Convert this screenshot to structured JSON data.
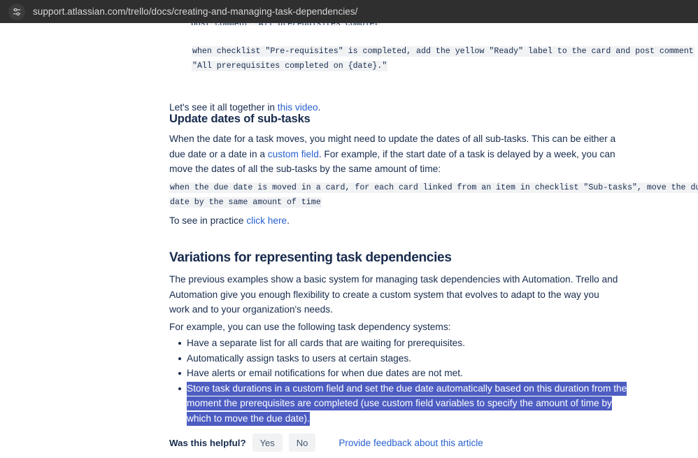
{
  "browser": {
    "url": "support.atlassian.com/trello/docs/creating-and-managing-task-dependencies/",
    "site_settings_icon": "sliders-icon"
  },
  "article": {
    "clipped_code_top": "post comment \"All prerequisites completed on {date}.\"",
    "code_block_1": {
      "line1": "when checklist \"Pre-requisites\" is completed, add the yellow \"Ready\" label to the card and post comment",
      "line2": "\"All prerequisites completed on {date}.\""
    },
    "video_sentence": {
      "before": "Let's see it all together in ",
      "link": "this video",
      "after": "."
    },
    "section_subtasks": {
      "heading": "Update dates of sub-tasks",
      "paragraph_part1": "When the date for a task moves, you might need to update the dates of all sub-tasks. This can be either a due date or a date in a ",
      "paragraph_link": "custom field",
      "paragraph_part2": ". For example, if the start date of a task is delayed by a week, you can move the dates of all the sub-tasks by the same amount of time:",
      "code_block": {
        "line1": "when the due date is moved in a card, for each card linked from an item in checklist \"Sub-tasks\", move the due",
        "line2": "date by the same amount of time"
      },
      "practice_before": "To see in practice ",
      "practice_link": "click here",
      "practice_after": "."
    },
    "section_variations": {
      "heading": "Variations for representing task dependencies",
      "paragraph": "The previous examples show a basic system for managing task dependencies with Automation. Trello and Automation give you enough flexibility to create a custom system that evolves to adapt to the way you work and to your organization's needs.",
      "list_intro": "For example, you can use the following task dependency systems:",
      "bullets": [
        {
          "text": "Have a separate list for all cards that are waiting for prerequisites.",
          "selected": false
        },
        {
          "text": "Automatically assign tasks to users at certain stages.",
          "selected": false
        },
        {
          "text": "Have alerts or email notifications for when due dates are not met.",
          "selected": false
        },
        {
          "text": "Store task durations in a custom field and set the due date automatically based on this duration from the moment the prerequisites are completed (use custom field variables to specify the amount of time by which to move the due date).",
          "selected": true
        }
      ]
    }
  },
  "footer": {
    "helpful_label": "Was this helpful?",
    "yes_label": "Yes",
    "no_label": "No",
    "feedback_link": "Provide feedback about this article"
  },
  "colors": {
    "urlbar_background": "#2f2f2f",
    "urlbar_text": "#d6d6d6",
    "heading_text": "#172b4d",
    "body_text": "#172b4d",
    "link": "#2860cf",
    "code_background": "#f1f2f4",
    "selection_highlight": "#4d5dc2",
    "button_background": "#f1f2f4",
    "page_background": "#ffffff"
  }
}
